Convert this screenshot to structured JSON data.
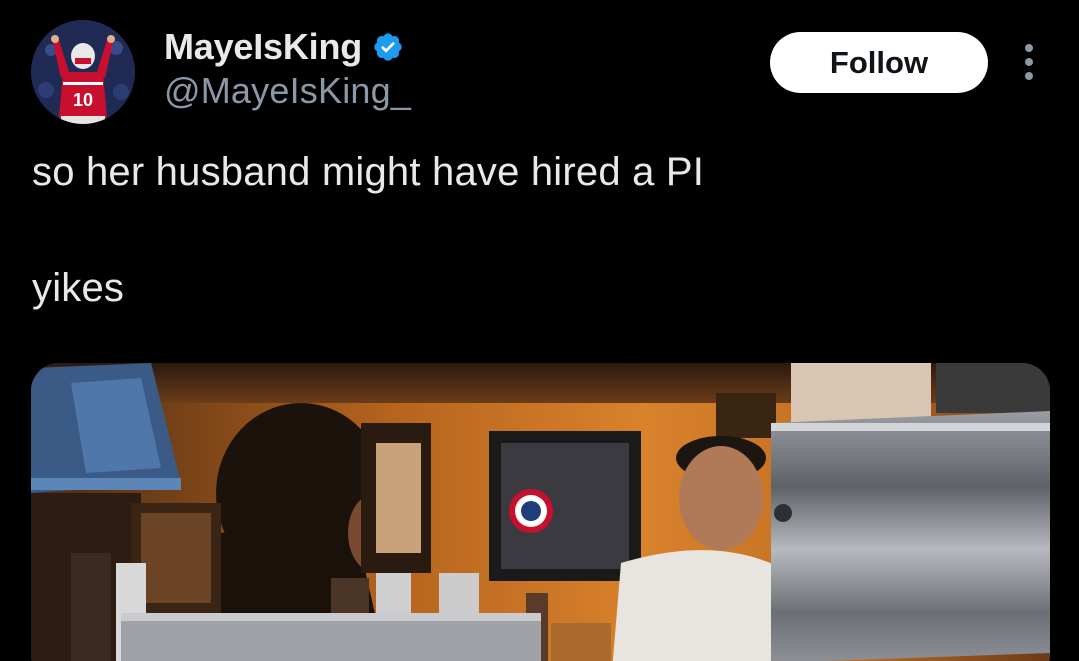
{
  "tweet": {
    "author": {
      "display_name": "MayeIsKing",
      "handle": "@MayeIsKing_",
      "verified": true,
      "avatar_icon": "avatar-photo-football-player",
      "avatar_jersey_number": "10"
    },
    "follow_label": "Follow",
    "more_icon": "more-vertical-icon",
    "text_lines": [
      "so her husband might have hired a PI",
      "yikes"
    ],
    "media": {
      "type": "photo",
      "description_icon": "photo-bar-scene"
    }
  },
  "colors": {
    "background": "#000000",
    "text_primary": "#e7e9ea",
    "text_secondary": "#8b98a5",
    "verified_blue": "#1d9bf0",
    "follow_bg": "#ffffff",
    "follow_text": "#0f1419"
  }
}
